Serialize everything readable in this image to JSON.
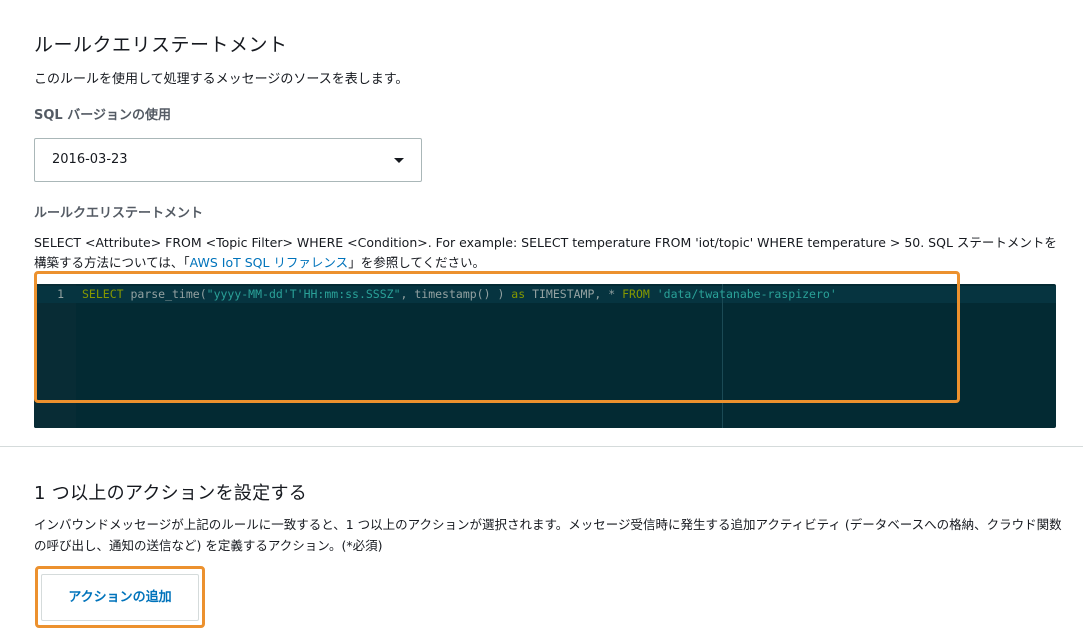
{
  "rule_query": {
    "heading": "ルールクエリステートメント",
    "description": "このルールを使用して処理するメッセージのソースを表します。",
    "sql_version_label": "SQL バージョンの使用",
    "sql_version_value": "2016-03-23",
    "statement_label": "ルールクエリステートメント",
    "help_text_before": "SELECT <Attribute> FROM <Topic Filter> WHERE <Condition>. For example: SELECT temperature FROM 'iot/topic' WHERE temperature > 50. SQL ステートメントを構築する方法については、「",
    "help_link": "AWS IoT SQL リファレンス",
    "help_text_after": "」を参照してください。",
    "editor": {
      "line_number": "1",
      "tokens": {
        "t1": "SELECT",
        "t2": " parse_time(",
        "t3": "\"yyyy-MM-dd'T'HH:mm:ss.SSSZ\"",
        "t4": ", timestamp() ) ",
        "t5": "as",
        "t6": " TIMESTAMP, * ",
        "t7": "FROM",
        "t8": " ",
        "t9": "'data/twatanabe-raspizero'"
      }
    }
  },
  "actions": {
    "heading": "1 つ以上のアクションを設定する",
    "description": "インバウンドメッセージが上記のルールに一致すると、1 つ以上のアクションが選択されます。メッセージ受信時に発生する追加アクティビティ (データベースへの格納、クラウド関数の呼び出し、通知の送信など) を定義するアクション。(*必須)",
    "add_button_label": "アクションの追加"
  },
  "colors": {
    "highlight": "#ec912e",
    "link": "#0073bb",
    "editor_background": "#032a33"
  }
}
